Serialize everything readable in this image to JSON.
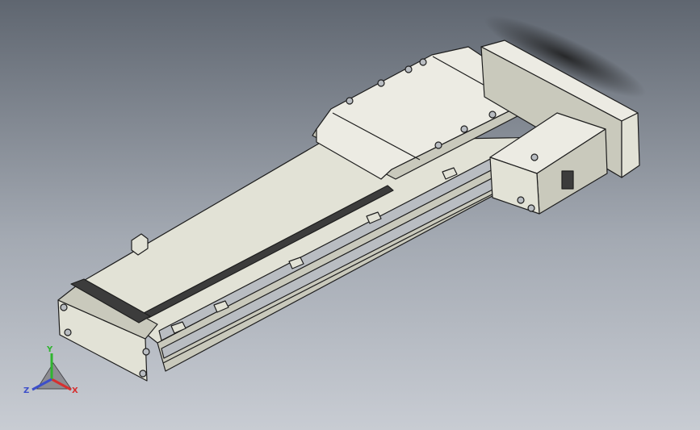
{
  "viewport": {
    "background_top": "#5f6670",
    "background_mid": "#a3a9b2",
    "background_bottom": "#c8ccd3"
  },
  "model": {
    "body_color": "#e2e2d6",
    "body_shade": "#c9c9bc",
    "outline_color": "#1e1e1e",
    "rail_color": "#b9bdc2",
    "rack_color": "#3c3c3c",
    "plate_color": "#ecebe3"
  },
  "triad": {
    "x_label": "X",
    "y_label": "Y",
    "z_label": "Z",
    "x_color": "#d63030",
    "y_color": "#2fb52f",
    "z_color": "#3d4fc9"
  }
}
